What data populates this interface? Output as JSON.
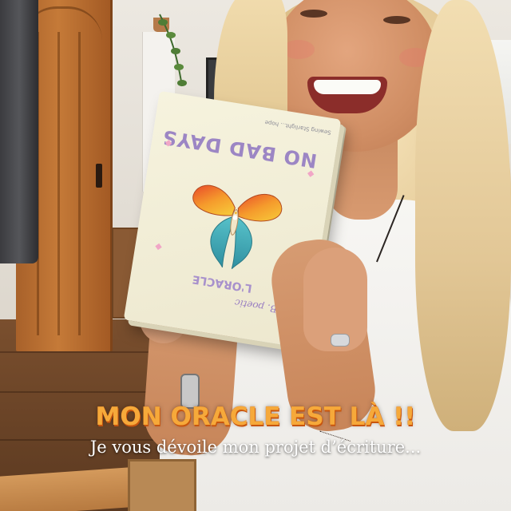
{
  "caption": {
    "title": "MON ORACLE EST LÀ !!",
    "subtitle": "Je vous dévoile mon projet d’écriture..."
  },
  "box": {
    "title": "NO BAD DAYS",
    "subtitle": "L'ORACLE",
    "signature": "B. poetic",
    "note": "Sewing Starlight... hope"
  },
  "colors": {
    "caption_title": "#f6a93a",
    "caption_title_shadow": "#c9560f",
    "caption_subtitle": "#ffffff",
    "box_background": "#f6f3de",
    "box_lettering": "#9c86c4"
  },
  "icons": [
    "butterfly-illustration",
    "sparkle-icon"
  ]
}
